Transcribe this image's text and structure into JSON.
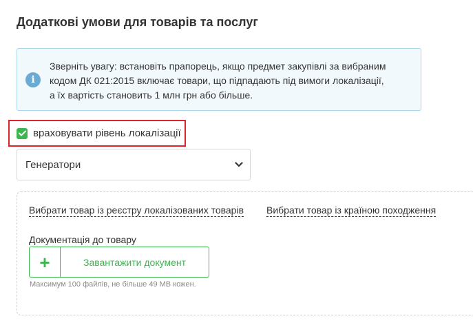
{
  "section": {
    "title": "Додаткові умови для товарів та послуг"
  },
  "notice": {
    "icon": "info-icon",
    "line1": "Зверніть увагу: встановіть прапорець, якщо предмет закупівлі за вибраним",
    "line2": "кодом ДК 021:2015 включає товари, що підпадають під вимоги локалізації,",
    "line3": "а їх вартість становить 1 млн грн або більше."
  },
  "localization": {
    "checked": true,
    "label": "враховувати рівень локалізації"
  },
  "product_select": {
    "value": "Генератори"
  },
  "product_links": {
    "registry": "Вибрати товар із реєстру локалізованих товарів",
    "country": "Вибрати товар із країною походження"
  },
  "documentation": {
    "label": "Документація до товару",
    "upload_plus": "+",
    "upload_button": "Завантажити документ",
    "hint": "Максимум 100 файлів, не більше 49 MB кожен."
  },
  "colors": {
    "accent_green": "#3db64e",
    "highlight_red": "#d9262e",
    "info_blue": "#6aaad3"
  }
}
